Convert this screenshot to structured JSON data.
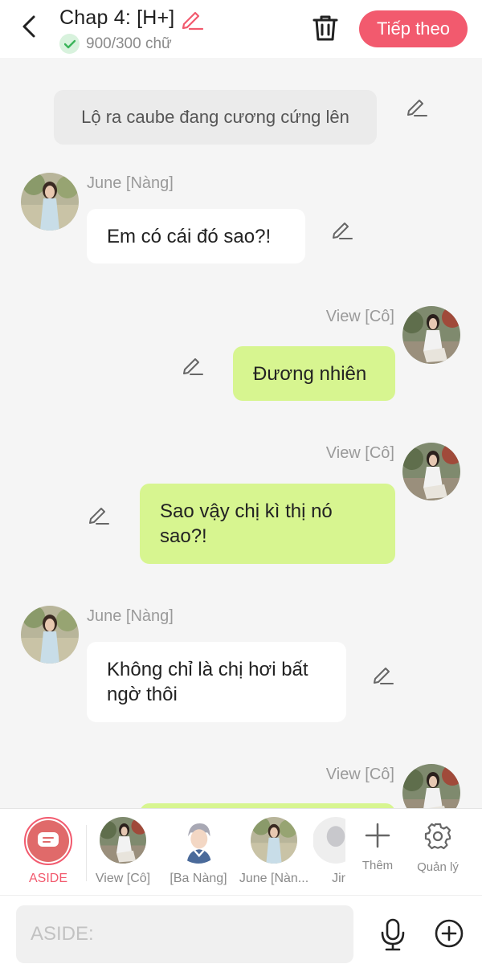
{
  "header": {
    "title": "Chap 4: [H+]",
    "word_count": "900/300 chữ",
    "next_label": "Tiếp theo",
    "accent_color": "#f25a6e"
  },
  "messages": [
    {
      "type": "narration",
      "text": "Lộ ra caube đang cương cứng lên"
    },
    {
      "type": "left",
      "sender": "June [Nàng]",
      "text": "Em có cái đó sao?!"
    },
    {
      "type": "right",
      "sender": "View [Cô]",
      "text": "Đương nhiên"
    },
    {
      "type": "right",
      "sender": "View [Cô]",
      "text": "Sao vậy chị kì thị nó sao?!"
    },
    {
      "type": "left",
      "sender": "June [Nàng]",
      "text": "Không chỉ là chị hơi bất ngờ thôi"
    },
    {
      "type": "right",
      "sender": "View [Cô]",
      "text": ""
    }
  ],
  "characters": {
    "aside_label": "ASIDE",
    "items": [
      {
        "label": "View [Cô]"
      },
      {
        "label": "[Ba Nàng]"
      },
      {
        "label": "June [Nàn..."
      },
      {
        "label": "Jir"
      }
    ],
    "add_label": "Thêm",
    "manage_label": "Quản lý"
  },
  "input": {
    "placeholder": "ASIDE:"
  }
}
